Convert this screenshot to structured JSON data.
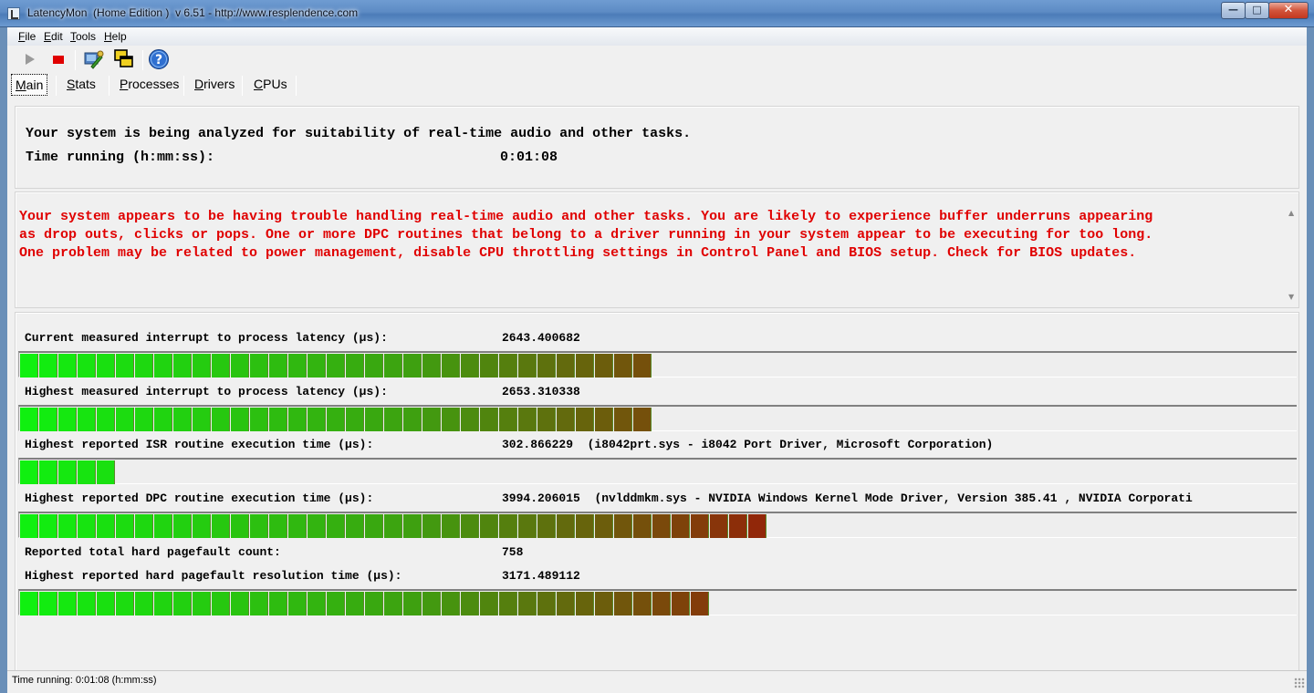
{
  "window": {
    "title": "LatencyMon  (Home Edition )  v 6.51 - http://www.resplendence.com",
    "minimize": "—",
    "maximize": "□",
    "close": "✕"
  },
  "menu": [
    {
      "accel": "F",
      "rest": "ile"
    },
    {
      "accel": "E",
      "rest": "dit"
    },
    {
      "accel": "T",
      "rest": "ools"
    },
    {
      "accel": "H",
      "rest": "elp"
    }
  ],
  "toolbar": {
    "icons": [
      "play-icon",
      "stop-icon",
      "tools-icon",
      "windows-icon",
      "help-icon"
    ],
    "stop_color": "#e00000"
  },
  "tabs": [
    {
      "accel": "M",
      "rest": "ain",
      "active": true
    },
    {
      "accel": "S",
      "rest": "tats",
      "active": false
    },
    {
      "accel": "P",
      "rest": "rocesses",
      "active": false
    },
    {
      "accel": "D",
      "rest": "rivers",
      "active": false
    },
    {
      "accel": "C",
      "rest": "PUs",
      "active": false
    }
  ],
  "header": {
    "analysis_line": "Your system is being analyzed for suitability of real-time audio and other tasks.",
    "time_label": "Time running (h:mm:ss):",
    "time_value": "0:01:08"
  },
  "verdict": {
    "text": "Your system appears to be having trouble handling real-time audio and other tasks. You are likely to experience buffer underruns appearing\nas drop outs, clicks or pops. One or more DPC routines that belong to a driver running in your system appear to be executing for too long.\nOne problem may be related to power management, disable CPU throttling settings in Control Panel and BIOS setup. Check for BIOS updates.",
    "color": "#e00000"
  },
  "stats": [
    {
      "label": "Current measured interrupt to process latency (µs):",
      "value": "2643.400682",
      "detail": "",
      "bar_segments": 33
    },
    {
      "label": "Highest measured interrupt to process latency (µs):",
      "value": "2653.310338",
      "detail": "",
      "bar_segments": 33
    },
    {
      "label": "Highest reported ISR routine execution time (µs):",
      "value": "302.866229",
      "detail": "(i8042prt.sys - i8042 Port Driver, Microsoft Corporation)",
      "bar_segments": 5
    },
    {
      "label": "Highest reported DPC routine execution time (µs):",
      "value": "3994.206015",
      "detail": "(nvlddmkm.sys - NVIDIA Windows Kernel Mode Driver, Version 385.41 , NVIDIA Corporati",
      "bar_segments": 39
    },
    {
      "label": "Reported total hard pagefault count:",
      "value": "758",
      "detail": "",
      "bar_segments": null
    },
    {
      "label": "Highest reported hard pagefault resolution time (µs):",
      "value": "3171.489112",
      "detail": "",
      "bar_segments": 36
    }
  ],
  "bar_colors": {
    "start": "#10f010",
    "mid": "#3ea010",
    "end": "#9a1a08"
  },
  "statusbar": {
    "text": "Time running: 0:01:08  (h:mm:ss)"
  }
}
